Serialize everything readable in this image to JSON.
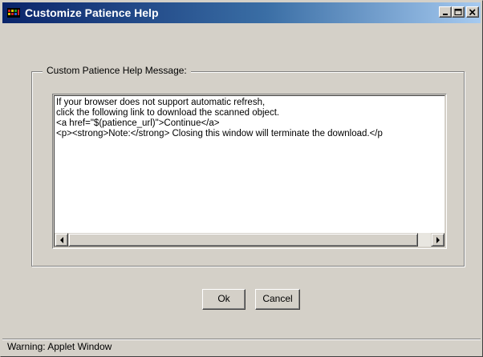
{
  "window": {
    "title": "Customize Patience Help",
    "controls": {
      "minimize": "_",
      "maximize": "□",
      "close": "✕"
    }
  },
  "groupbox": {
    "label": "Custom Patience Help Message:"
  },
  "message": {
    "lines": [
      "If your browser does not support automatic refresh,",
      "click the following link to download the scanned object.",
      "<a href=\"$(patience_url)\">Continue</a>",
      "<p><strong>Note:</strong> Closing this window will terminate the download.</p"
    ]
  },
  "buttons": {
    "ok": "Ok",
    "cancel": "Cancel"
  },
  "status": {
    "text": "Warning: Applet Window"
  },
  "colors": {
    "face": "#d4d0c8",
    "title_start": "#0a246a",
    "title_end": "#a6caf0"
  }
}
